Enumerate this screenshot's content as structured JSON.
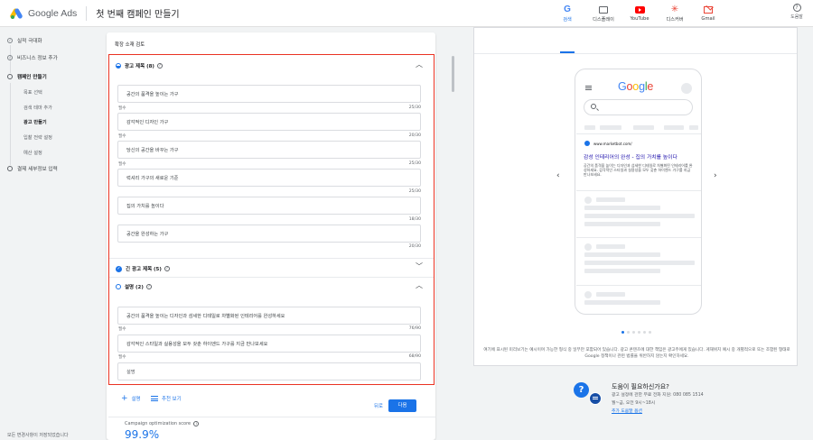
{
  "app": {
    "brand": "Google Ads",
    "title": "첫 번째 캠페인 만들기",
    "help_label": "도움말"
  },
  "sidebar": {
    "items": [
      {
        "label": "실적 극대화"
      },
      {
        "label": "비즈니스 정보 추가"
      },
      {
        "label": "캠페인 만들기"
      },
      {
        "label": "결제 세부정보 입력"
      }
    ],
    "sub_items": [
      "목표 선택",
      "검색 테마 추가",
      "광고 만들기",
      "입찰 전략 설정",
      "예산 설정"
    ],
    "footer": "모든 변경사항이 저장되었습니다"
  },
  "main": {
    "card_title": "확장 소재 검토",
    "headlines": {
      "title": "광고 제목 (8)",
      "fields": [
        {
          "text": "공간의 품격을 높이는 가구",
          "label": "필수",
          "count": "25/30"
        },
        {
          "text": "감각적인 디자인 가구",
          "label": "필수",
          "count": "20/30"
        },
        {
          "text": "당신의 공간을 바꾸는 가구",
          "label": "필수",
          "count": "25/30"
        },
        {
          "text": "럭셔리 가구의 새로운 기준",
          "label": "",
          "count": "25/30"
        },
        {
          "text": "집의 가치를 높이다",
          "label": "",
          "count": "18/30"
        },
        {
          "text": "공간을 완성하는 가구",
          "label": "",
          "count": "20/30"
        }
      ]
    },
    "long_headlines": {
      "title": "긴 광고 제목 (5)"
    },
    "descriptions": {
      "title": "설명 (2)",
      "fields": [
        {
          "text": "공간의 품격을 높이는 디자인과 섬세한 디테일로 차별화된 인테리어를 완성하세요",
          "label": "필수",
          "count": "76/90"
        },
        {
          "text": "감각적인 스타일과 실용성을 모두 갖춘 하이엔드 가구를 지금 만나보세요",
          "label": "필수",
          "count": "68/90"
        },
        {
          "placeholder": "설명",
          "label": "",
          "count": ""
        }
      ]
    },
    "add_label": "설명",
    "recommend_label": "추천 보기",
    "optimization": {
      "label": "Campaign optimization score",
      "score": "99.9%"
    },
    "back_label": "뒤로",
    "next_label": "다음"
  },
  "preview": {
    "tabs": [
      {
        "label": "검색",
        "icon": "google-g-icon"
      },
      {
        "label": "디스플레이",
        "icon": "display-icon"
      },
      {
        "label": "YouTube",
        "icon": "youtube-icon"
      },
      {
        "label": "디스커버",
        "icon": "discover-icon"
      },
      {
        "label": "Gmail",
        "icon": "gmail-icon"
      }
    ],
    "logo": "Google",
    "ad": {
      "url": "www.marketbot.com/",
      "headline": "감성 인테리어의 완성 - 집의 가치를 높이다",
      "description": "공간의 품격을 높이는 디자인과 섬세한 디테일로 차별화된 인테리어를 완성하세요. 감각적인 스타일과 실용성을 모두 갖춘 하이엔드 가구를 지금 만나보세요."
    },
    "disclaimer": "여기에 표시된 미리보기는 예시이며 가능한 형식 중 일부만 포함되어 있습니다. 광고 콘텐츠에 대한 책임은 광고주에게 있습니다. 게재위치 예시 중 개별적으로 또는 조합된 형태로 Google 정책이나 관련 법률을 위반하지 않는지 확인하세요."
  },
  "help": {
    "title": "도움이 필요하신가요?",
    "line1": "광고 설정에 관한 무료 전화 지원: 080 085 1514",
    "line2": "월~금, 오전 9시~18시",
    "link": "추가 도움말 옵션"
  },
  "colors": {
    "accent": "#1a73e8",
    "highlight_border": "#ea3323",
    "ad_link": "#1a0dab"
  }
}
